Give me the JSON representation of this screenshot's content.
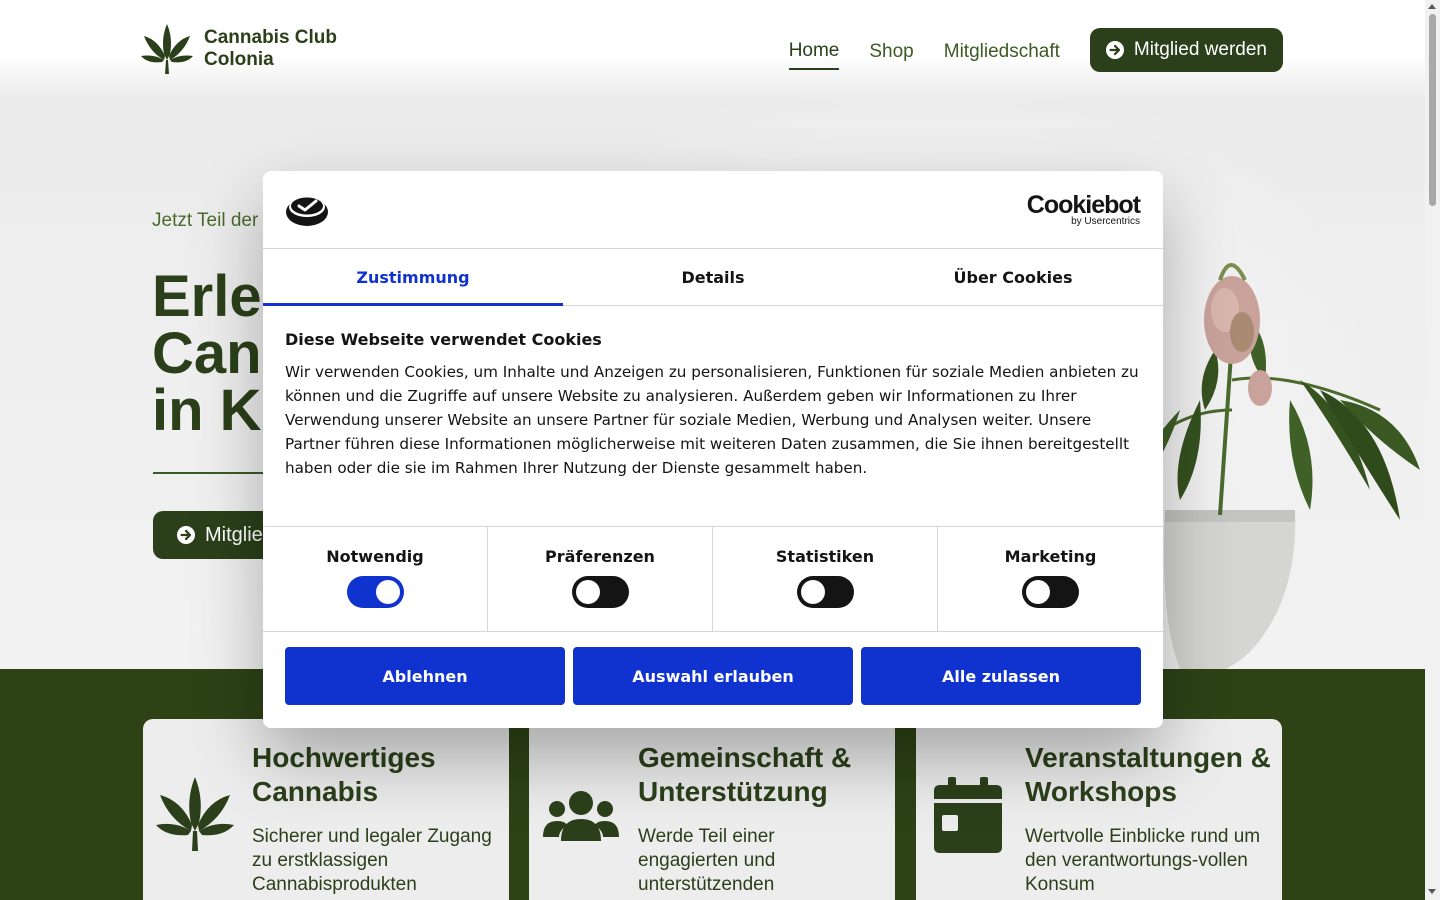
{
  "brand": {
    "name": "Cannabis Club Colonia",
    "logo_icon": "cannabis-leaf-icon",
    "accent": "#2b401a"
  },
  "nav": {
    "items": [
      {
        "label": "Home",
        "active": true
      },
      {
        "label": "Shop",
        "active": false
      },
      {
        "label": "Mitgliedschaft",
        "active": false
      }
    ],
    "cta_label": "Mitglied werden"
  },
  "hero": {
    "kicker": "Jetzt Teil der",
    "title_lines": [
      "Erle",
      "Can",
      "in K"
    ],
    "cta_label": "Mitglie"
  },
  "features": [
    {
      "icon": "cannabis-leaf-icon",
      "title": "Hochwertiges Cannabis",
      "text": "Sicherer und legaler Zugang zu erstklassigen Cannabisprodukten"
    },
    {
      "icon": "users-group-icon",
      "title": "Gemeinschaft & Unterstützung",
      "text": "Werde Teil einer engagierten und unterstützenden"
    },
    {
      "icon": "calendar-icon",
      "title": "Veranstaltungen & Workshops",
      "text": "Wertvolle Einblicke rund um den verantwortungs-vollen Konsum"
    }
  ],
  "cookie_dialog": {
    "provider_name": "Cookiebot",
    "provider_by": "by Usercentrics",
    "accent": "#1032cf",
    "tabs": [
      {
        "label": "Zustimmung",
        "active": true
      },
      {
        "label": "Details",
        "active": false
      },
      {
        "label": "Über Cookies",
        "active": false
      }
    ],
    "heading": "Diese Webseite verwendet Cookies",
    "body": "Wir verwenden Cookies, um Inhalte und Anzeigen zu personalisieren, Funktionen für soziale Medien anbieten zu können und die Zugriffe auf unsere Website zu analysieren. Außerdem geben wir Informationen zu Ihrer Verwendung unserer Website an unsere Partner für soziale Medien, Werbung und Analysen weiter. Unsere Partner führen diese Informationen möglicherweise mit weiteren Daten zusammen, die Sie ihnen bereitgestellt haben oder die sie im Rahmen Ihrer Nutzung der Dienste gesammelt haben.",
    "categories": [
      {
        "label": "Notwendig",
        "enabled": true
      },
      {
        "label": "Präferenzen",
        "enabled": false
      },
      {
        "label": "Statistiken",
        "enabled": false
      },
      {
        "label": "Marketing",
        "enabled": false
      }
    ],
    "buttons": {
      "decline": "Ablehnen",
      "allow_selection": "Auswahl erlauben",
      "allow_all": "Alle zulassen"
    }
  }
}
